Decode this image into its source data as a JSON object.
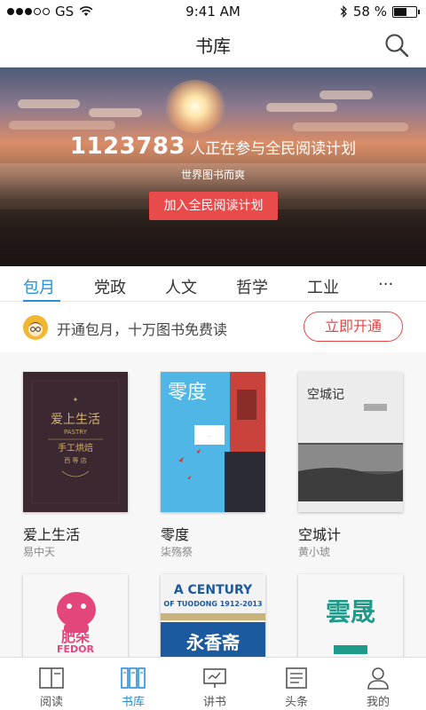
{
  "status_bar": {
    "carrier": "GS",
    "time": "9:41 AM",
    "battery": "58 %",
    "battery_level": 0.58,
    "signal_dots_filled": 3,
    "signal_dots_total": 5
  },
  "header": {
    "title": "书库"
  },
  "banner": {
    "count": "1123783",
    "count_text": "人正在参与全民阅读计划",
    "subtitle": "世界图书而爽",
    "button": "加入全民阅读计划"
  },
  "tabs": [
    {
      "label": "包月",
      "active": true
    },
    {
      "label": "党政"
    },
    {
      "label": "人文"
    },
    {
      "label": "哲学"
    },
    {
      "label": "工业"
    },
    {
      "label": "···"
    }
  ],
  "promo": {
    "text": "开通包月，十万图书免费读",
    "button": "立即开通"
  },
  "books": [
    {
      "title": "爱上生活",
      "author": "易中天",
      "cover_lines": [
        "爱上生活",
        "PASTRY",
        "手工烘焙",
        "西 等 店"
      ]
    },
    {
      "title": "零度",
      "author": "柒殇祭",
      "cover_lines": [
        "零度"
      ]
    },
    {
      "title": "空城计",
      "author": "黄小琥",
      "cover_lines": [
        "空城记"
      ]
    },
    {
      "title": "",
      "author": "",
      "cover_lines": [
        "肥朵",
        "FEDOR"
      ]
    },
    {
      "title": "",
      "author": "",
      "cover_lines": [
        "A CENTURY",
        "OF TUODONG 1912-2013",
        "永香斋"
      ]
    },
    {
      "title": "",
      "author": "",
      "cover_lines": [
        "雲晟"
      ]
    }
  ],
  "nav": [
    {
      "label": "阅读",
      "icon": "book-open-icon"
    },
    {
      "label": "书库",
      "icon": "bookshelf-icon",
      "active": true
    },
    {
      "label": "讲书",
      "icon": "presentation-icon"
    },
    {
      "label": "头条",
      "icon": "news-icon"
    },
    {
      "label": "我的",
      "icon": "user-icon"
    }
  ],
  "colors": {
    "accent_blue": "#2a8fd6",
    "accent_red": "#e94b4b"
  }
}
